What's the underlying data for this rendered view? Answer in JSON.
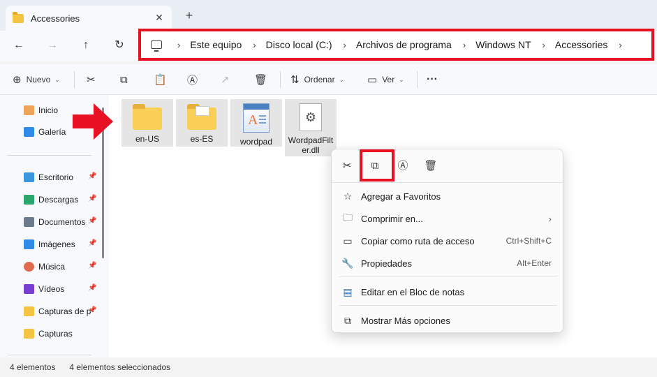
{
  "tab": {
    "title": "Accessories",
    "close": "✕",
    "new": "+"
  },
  "nav": {
    "back": "←",
    "forward": "→",
    "up": "↑",
    "refresh": "↻"
  },
  "address": {
    "crumbs": [
      "Este equipo",
      "Disco local (C:)",
      "Archivos de programa",
      "Windows NT",
      "Accessories"
    ],
    "separator": "›"
  },
  "toolbar": {
    "new_label": "Nuevo",
    "sort_label": "Ordenar",
    "view_label": "Ver",
    "more": "···"
  },
  "sidebar": {
    "top_items": [
      {
        "label": "Inicio"
      },
      {
        "label": "Galería"
      }
    ],
    "pinned_items": [
      {
        "label": "Escritorio",
        "color": "#3a96dd"
      },
      {
        "label": "Descargas",
        "color": "#2aa56b"
      },
      {
        "label": "Documentos",
        "color": "#6b7b8c"
      },
      {
        "label": "Imágenes",
        "color": "#2f8be6"
      },
      {
        "label": "Música",
        "color": "#e06c4f"
      },
      {
        "label": "Vídeos",
        "color": "#7a3fd1"
      },
      {
        "label": "Capturas de p",
        "color": "#f4c542"
      },
      {
        "label": "Capturas",
        "color": "#f4c542"
      }
    ],
    "pin_glyph": "📌"
  },
  "files": [
    {
      "name": "en-US",
      "kind": "folder"
    },
    {
      "name": "es-ES",
      "kind": "folder-docs"
    },
    {
      "name": "wordpad",
      "kind": "wordpad"
    },
    {
      "name": "WordpadFilter.dll",
      "kind": "dll"
    }
  ],
  "context_menu": {
    "items": [
      {
        "label": "Agregar a Favoritos",
        "icon": "star-icon",
        "glyph": "☆",
        "shortcut": ""
      },
      {
        "label": "Comprimir en...",
        "icon": "zip-icon",
        "glyph": "🗀",
        "shortcut": "",
        "submenu": "›"
      },
      {
        "label": "Copiar como ruta de acceso",
        "icon": "path-icon",
        "glyph": "▭",
        "shortcut": "Ctrl+Shift+C"
      },
      {
        "label": "Propiedades",
        "icon": "wrench-icon",
        "glyph": "🔧",
        "shortcut": "Alt+Enter"
      },
      {
        "label": "Editar en el Bloc de notas",
        "icon": "notepad-icon",
        "glyph": "▤",
        "shortcut": ""
      },
      {
        "label": "Mostrar Más opciones",
        "icon": "more-options-icon",
        "glyph": "⧉",
        "shortcut": ""
      }
    ]
  },
  "status": {
    "count": "4 elementos",
    "selected": "4 elementos seleccionados"
  },
  "colors": {
    "highlight_red": "#e81123",
    "selection_gray": "#e5e5e5",
    "folder_yellow": "#f9cf55"
  }
}
